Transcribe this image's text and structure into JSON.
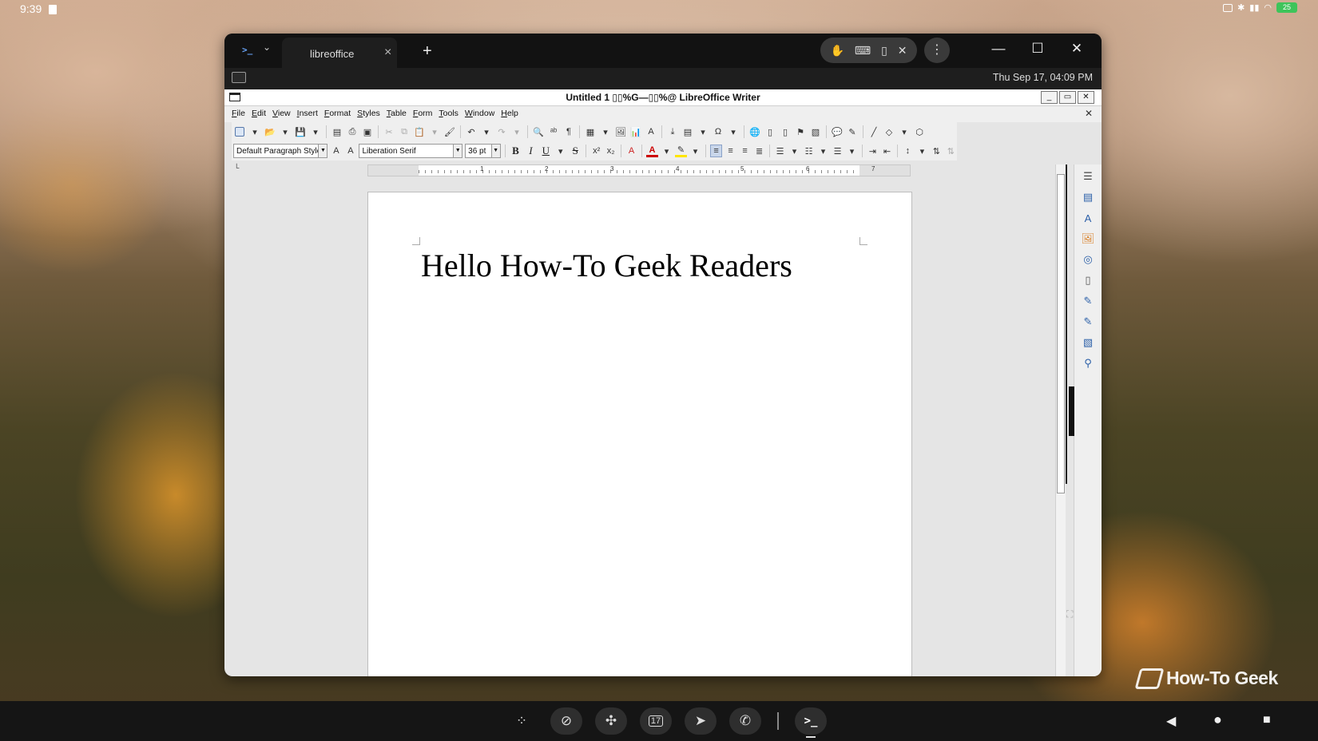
{
  "status_bar": {
    "time": "9:39",
    "battery": "25"
  },
  "terminal": {
    "tab_label": "libreoffice",
    "datetime": "Thu Sep 17, 04:09 PM",
    "app_icon": ">_",
    "add_tab": "+",
    "close_tab": "×"
  },
  "writer": {
    "title": "Untitled 1 ▯▯%G—▯▯%@ LibreOffice Writer",
    "menu": [
      "File",
      "Edit",
      "View",
      "Insert",
      "Format",
      "Styles",
      "Table",
      "Form",
      "Tools",
      "Window",
      "Help"
    ],
    "paragraph_style": "Default Paragraph Style",
    "font_name": "Liberation Serif",
    "font_size": "36 pt",
    "ruler_numbers": [
      "1",
      "2",
      "3",
      "4",
      "5",
      "6",
      "7"
    ],
    "document_text": "Hello How-To Geek Readers"
  },
  "watermark": {
    "text": "How-To Geek"
  },
  "taskbar": {
    "apps": [
      "app-drawer-icon",
      "vpn-icon",
      "tools-icon",
      "calendar-icon",
      "arrow-app-icon",
      "phone-icon",
      "terminal-icon"
    ],
    "calendar_day": "17",
    "terminal_glyph": ">_"
  }
}
